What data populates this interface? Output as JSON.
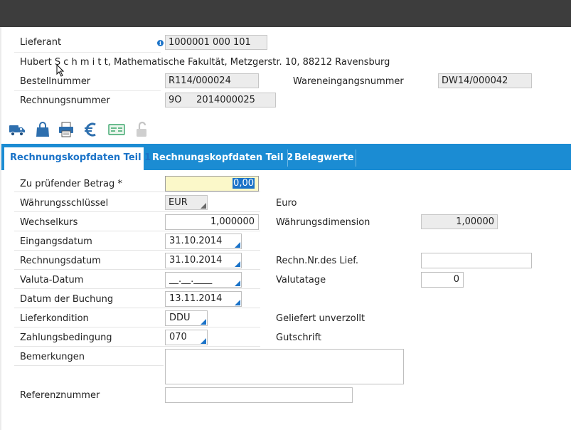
{
  "header": {
    "lieferant_label": "Lieferant",
    "lieferant_value": "1000001 000 101",
    "supplier_address": "Hubert S c h m i t t, Mathematische Fakultät, Metzgerstr. 10, 88212 Ravensburg",
    "bestellnummer_label": "Bestellnummer",
    "bestellnummer_value": "R114/000024",
    "wareneingang_label": "Wareneingangsnummer",
    "wareneingang_value": "DW14/000042",
    "rechnungsnummer_label": "Rechnungsnummer",
    "rechnungsnummer_value": "9O     2014000025"
  },
  "toolbar": {
    "icons": [
      "truck-icon",
      "shopping-bag-icon",
      "printer-icon",
      "euro-icon",
      "payment-card-icon",
      "unlock-icon"
    ]
  },
  "tabs": [
    {
      "label": "Rechnungskopfdaten Teil 1",
      "active": true
    },
    {
      "label": "Rechnungskopfdaten Teil 2",
      "active": false
    },
    {
      "label": "Belegwerte",
      "active": false
    }
  ],
  "form": {
    "betrag_label": "Zu prüfender Betrag *",
    "betrag_value": "0,00",
    "waehrung_label": "Währungsschlüssel",
    "waehrung_value": "EUR",
    "waehrung_text": "Euro",
    "wechselkurs_label": "Wechselkurs",
    "wechselkurs_value": "1,000000",
    "waehrungsdimension_label": "Währungsdimension",
    "waehrungsdimension_value": "1,00000",
    "eingangsdatum_label": "Eingangsdatum",
    "eingangsdatum_value": "31.10.2014",
    "rechnungsdatum_label": "Rechnungsdatum",
    "rechnungsdatum_value": "31.10.2014",
    "rechn_nr_lief_label": "Rechn.Nr.des Lief.",
    "rechn_nr_lief_value": "",
    "valuta_label": "Valuta-Datum",
    "valuta_value": "__.__.____",
    "valutatage_label": "Valutatage",
    "valutatage_value": "0",
    "buchung_label": "Datum der Buchung",
    "buchung_value": "13.11.2014",
    "lieferkondition_label": "Lieferkondition",
    "lieferkondition_value": "DDU",
    "lieferkondition_text": "Geliefert unverzollt",
    "zahlungsbedingung_label": "Zahlungsbedingung",
    "zahlungsbedingung_value": "070",
    "zahlungsbedingung_text": "Gutschrift",
    "bemerkungen_label": "Bemerkungen",
    "bemerkungen_value": "",
    "referenznummer_label": "Referenznummer",
    "referenznummer_value": ""
  },
  "colors": {
    "accent": "#1b73c8",
    "tabbar": "#1b8cd3",
    "titlebar": "#3d3d3d",
    "focus_field": "#fbf8c9"
  }
}
